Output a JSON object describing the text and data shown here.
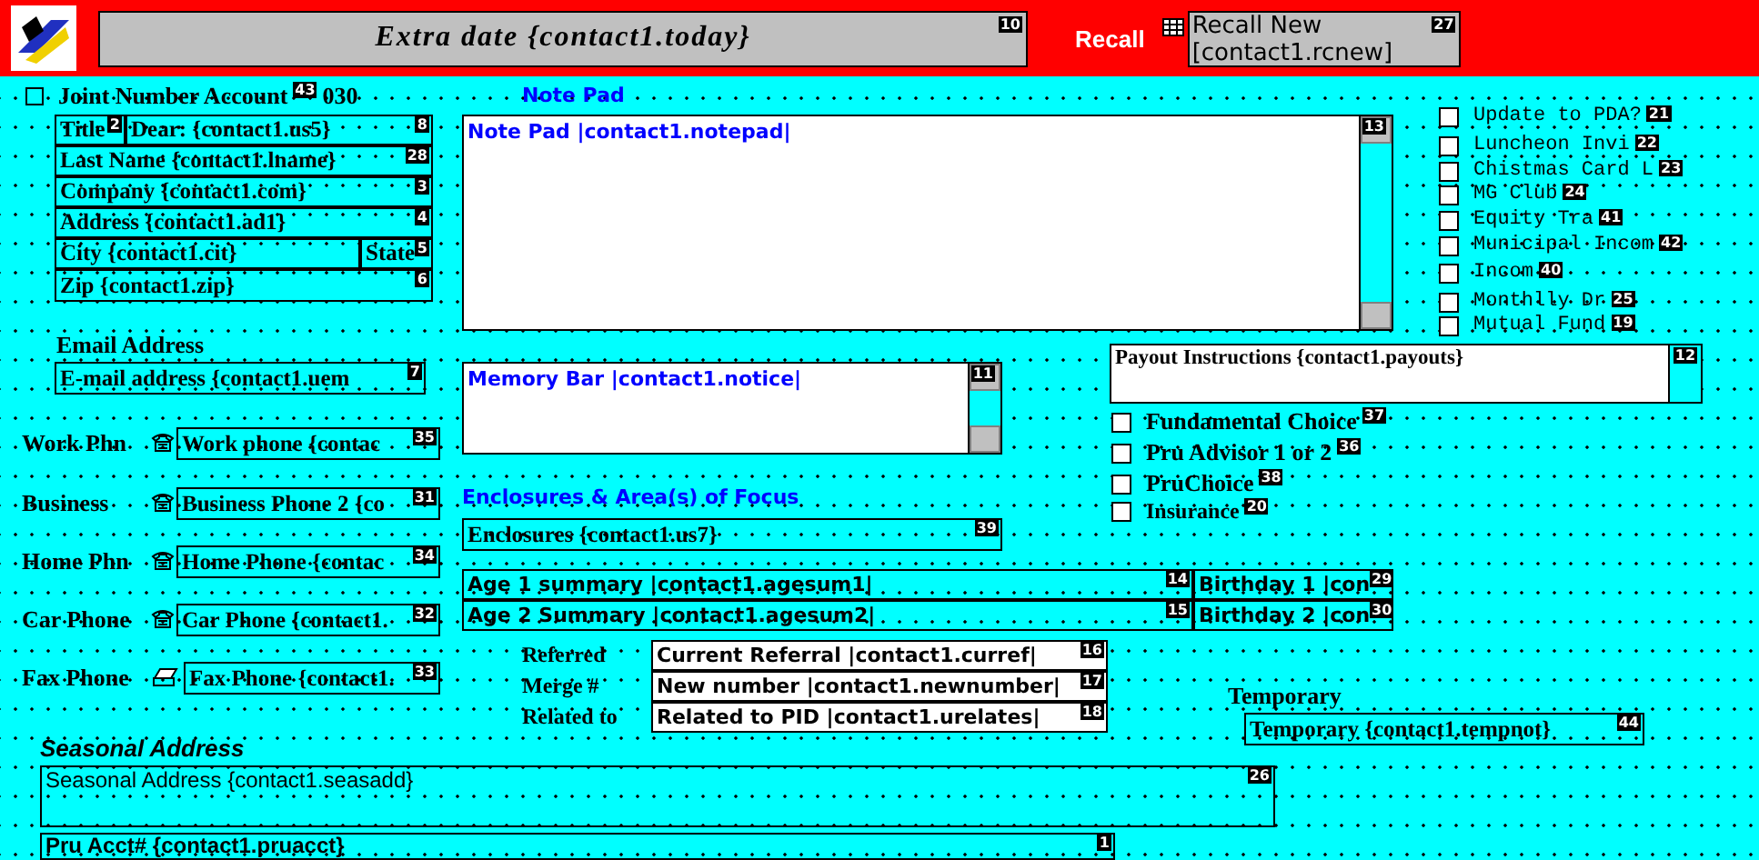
{
  "header": {
    "title": "Extra date {contact1.today}",
    "title_badge": "10",
    "recall_label": "Recall",
    "recall_lines": [
      "Recall New",
      "[contact1.rcnew]"
    ],
    "recall_badge": "27"
  },
  "joint_account": {
    "label": "Joint Number Account",
    "badge": "43",
    "suffix": "030",
    "checked": false
  },
  "address_fields": [
    {
      "text": "Title",
      "badge": "2"
    },
    {
      "text": "Dear: {contact1.us5}",
      "badge": "8"
    },
    {
      "text": "Last Name {contact1.lname}",
      "badge": "28"
    },
    {
      "text": "Company {contact1.com}",
      "badge": "3"
    },
    {
      "text": "Address {contact1.ad1}",
      "badge": "4"
    },
    {
      "text": "City {contact1.cit}"
    },
    {
      "text": "State",
      "badge": "5"
    },
    {
      "text": "Zip {contact1.zip}",
      "badge": "6"
    }
  ],
  "email": {
    "label": "Email Address",
    "value": "E-mail address {contact1.uem",
    "badge": "7"
  },
  "phone_rows": [
    {
      "kind": "phone",
      "label": "Work Phn",
      "value": "Work phone {contac",
      "badge": "35"
    },
    {
      "kind": "phone",
      "label": "Business",
      "value": "Business Phone 2 {co",
      "badge": "31"
    },
    {
      "kind": "phone",
      "label": "Home Phn",
      "value": "Home Phone {contac",
      "badge": "34"
    },
    {
      "kind": "phone",
      "label": "Car Phone",
      "value": "Car Phone {contact1.",
      "badge": "32"
    },
    {
      "kind": "fax",
      "label": "Fax Phone",
      "value": "Fax Phone {contact1.",
      "badge": "33"
    }
  ],
  "note_pad": {
    "label": "Note Pad",
    "value": "Note Pad |contact1.notepad|",
    "badge": "13"
  },
  "memory_bar": {
    "value": "Memory Bar |contact1.notice|",
    "badge": "11"
  },
  "enclosures": {
    "heading": "Enclosures & Area(s) of Focus",
    "value": "Enclosures {contact1.us7}",
    "badge": "39"
  },
  "summaries": [
    {
      "text": "Age 1 summary |contact1.agesum1|",
      "badge": "14"
    },
    {
      "text": "Birthday 1 |con",
      "badge": "29"
    },
    {
      "text": "Age 2 Summary |contact1.agesum2|",
      "badge": "15"
    },
    {
      "text": "Birthday 2 |con",
      "badge": "30"
    }
  ],
  "references": [
    {
      "label": "Referred",
      "value": "Current Referral |contact1.curref|",
      "badge": "16"
    },
    {
      "label": "Merge #",
      "value": "New number |contact1.newnumber|",
      "badge": "17"
    },
    {
      "label": "Related to",
      "value": "Related to PID |contact1.urelates|",
      "badge": "18"
    }
  ],
  "temporary": {
    "label": "Temporary",
    "value": "Temporary {contact1.tempnot}",
    "badge": "44"
  },
  "seasonal_address": {
    "label": "Seasonal Address",
    "value": "Seasonal Address {contact1.seasadd}",
    "badge": "26"
  },
  "pru_account": {
    "value": "Pru Acct# {contact1.pruacct}",
    "badge": "1"
  },
  "mailing_flags": [
    {
      "label": "Update to PDA?",
      "badge": "21",
      "checked": false
    },
    {
      "label": "Luncheon Invi",
      "badge": "22",
      "checked": false
    },
    {
      "label": "Chistmas Card L",
      "badge": "23",
      "checked": false
    },
    {
      "label": "MG Club",
      "badge": "24",
      "checked": false
    },
    {
      "label": "Equity Tra",
      "badge": "41",
      "checked": false
    },
    {
      "label": "Municipal Incom",
      "badge": "42",
      "checked": false
    },
    {
      "label": "Incom",
      "badge": "40",
      "checked": false
    },
    {
      "label": "Monthlly Dr",
      "badge": "25",
      "checked": false
    },
    {
      "label": "Mutual Fund",
      "badge": "19",
      "checked": false
    }
  ],
  "payout": {
    "value": "Payout Instructions {contact1.payouts}",
    "badge": "12"
  },
  "product_flags": [
    {
      "label": "Fundamental Choice",
      "badge": "37",
      "checked": false
    },
    {
      "label": "Pru Advisor 1 or 2",
      "badge": "36",
      "checked": false
    },
    {
      "label": "PruChoice",
      "badge": "38",
      "checked": false
    },
    {
      "label": "Insurance",
      "badge": "20",
      "checked": false
    }
  ]
}
